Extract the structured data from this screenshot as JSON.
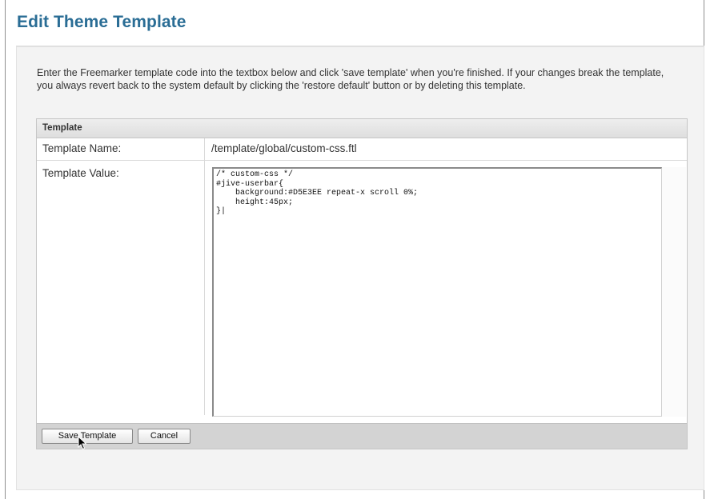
{
  "page": {
    "title": "Edit Theme Template",
    "intro": "Enter the Freemarker template code into the textbox below and click 'save template' when you're finished. If your changes break the template, you always revert back to the system default by clicking the 'restore default' button or by deleting this template."
  },
  "table": {
    "header": "Template",
    "name_label": "Template Name:",
    "name_value": "/template/global/custom-css.ftl",
    "value_label": "Template Value:",
    "value_code": "/* custom-css */\n#jive-userbar{\n    background:#D5E3EE repeat-x scroll 0%;\n    height:45px;\n}|"
  },
  "buttons": {
    "save": "Save Template",
    "cancel": "Cancel"
  },
  "icons": {
    "cursor": "mouse-pointer-icon"
  }
}
